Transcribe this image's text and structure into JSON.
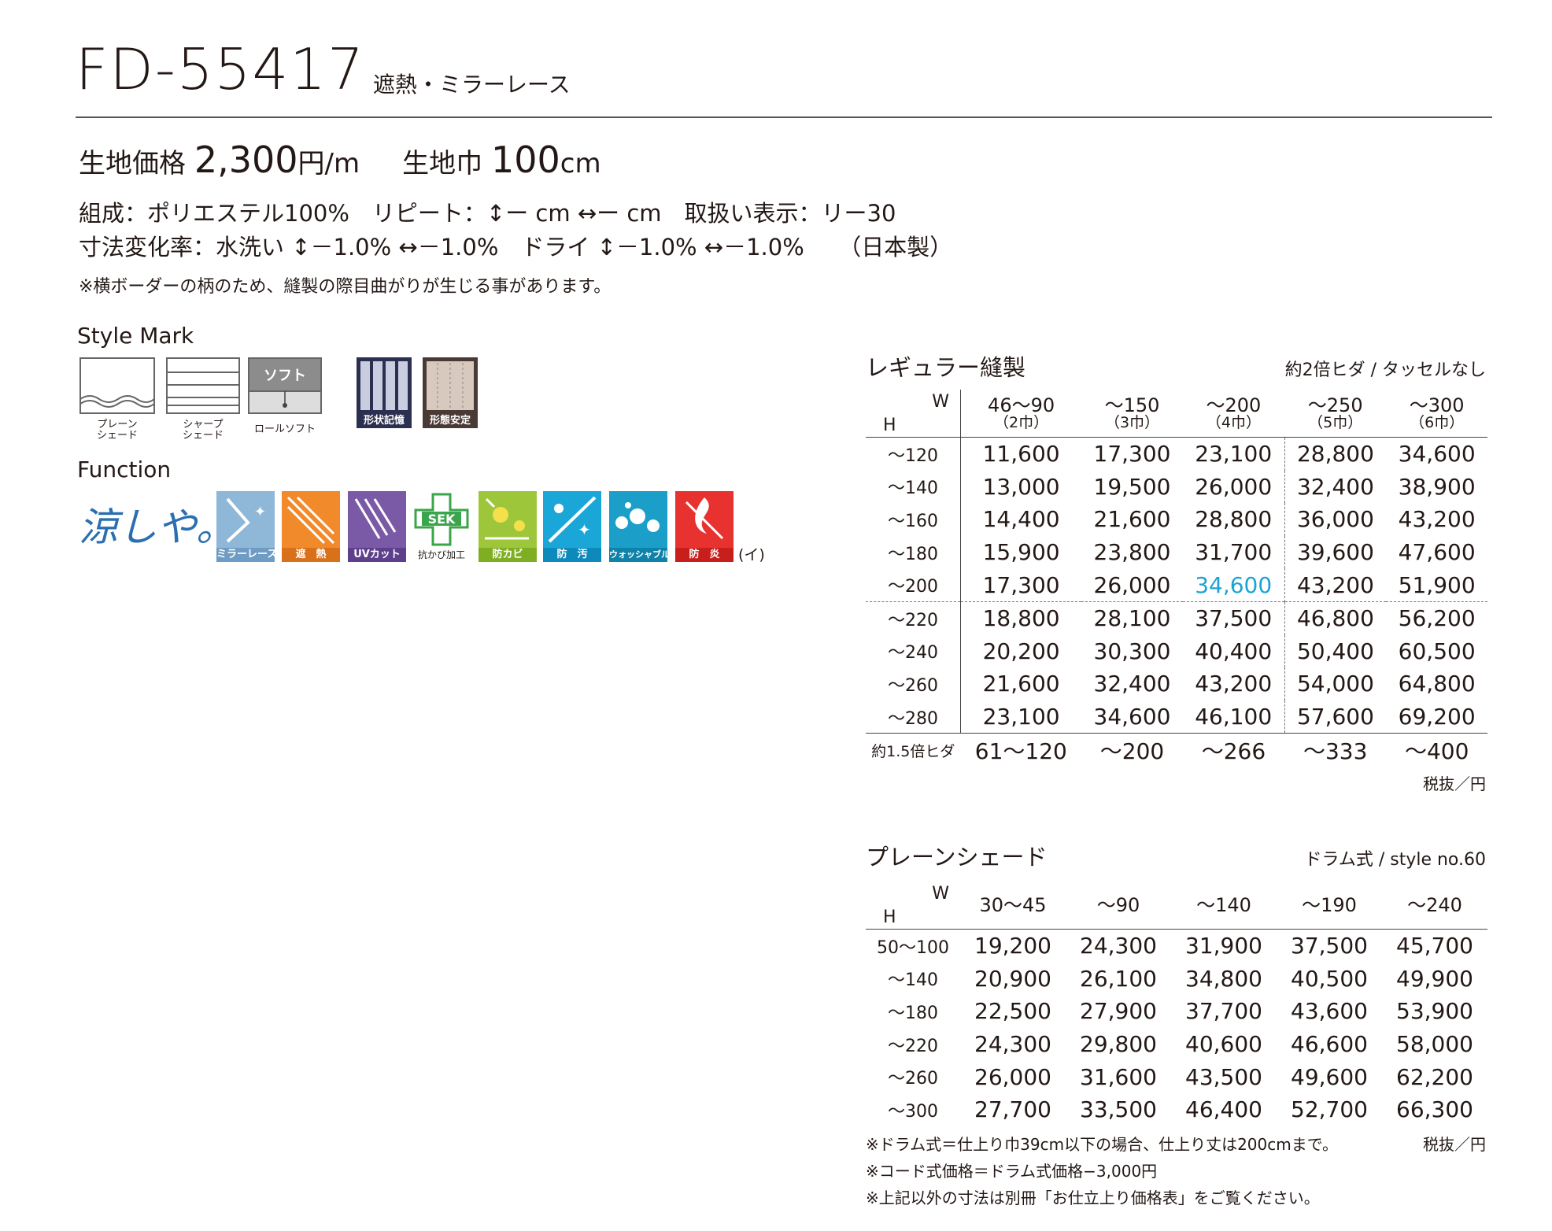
{
  "header": {
    "code": "FD-55417",
    "subtitle": "遮熱・ミラーレース"
  },
  "price": {
    "label": "生地価格",
    "value": "2,300",
    "unit": "円/m",
    "width_label": "生地巾",
    "width_value": "100",
    "width_unit": "cm"
  },
  "specs": {
    "line1": "組成：ポリエステル100%　リピート：↕ー cm ↔ー cm　取扱い表示：リー30",
    "line2": "寸法変化率：水洗い ↕－1.0% ↔－1.0%　ドライ ↕－1.0% ↔－1.0%　　（日本製）",
    "note": "※横ボーダーの柄のため、縫製の際目曲がりが生じる事があります。"
  },
  "style_mark": {
    "heading": "Style Mark",
    "items": [
      {
        "caption1": "プレーン",
        "caption2": "シェード",
        "icon": "plain-shade-icon"
      },
      {
        "caption1": "シャープ",
        "caption2": "シェード",
        "icon": "sharp-shade-icon"
      },
      {
        "caption1": "ロールソフト",
        "caption2": "",
        "label": "ソフト",
        "icon": "roll-soft-icon"
      },
      {
        "caption1": "形状記憶",
        "caption2": "",
        "icon": "shape-memory-icon"
      },
      {
        "caption1": "形態安定",
        "caption2": "",
        "icon": "form-stable-icon"
      }
    ]
  },
  "function": {
    "heading": "Function",
    "logo": "涼しや。",
    "items": [
      {
        "label": "ミラーレース",
        "color": "#8fb7d8",
        "icon": "mirror-lace-icon"
      },
      {
        "label": "遮　熱",
        "color": "#f08a2a",
        "icon": "heat-shield-icon"
      },
      {
        "label": "UVカット",
        "color": "#7a5aa6",
        "icon": "uv-cut-icon"
      },
      {
        "label": "SEK",
        "sub": "抗かび加工",
        "color": "#3aa54a",
        "icon": "sek-icon"
      },
      {
        "label": "防カビ",
        "color": "#9dc63a",
        "icon": "anti-mold-icon"
      },
      {
        "label": "防　汚",
        "color": "#1aa7d8",
        "icon": "anti-stain-icon"
      },
      {
        "label": "ウォッシャブル",
        "color": "#1b9fc8",
        "icon": "washable-icon"
      },
      {
        "label": "防　炎",
        "color": "#e8322f",
        "icon": "flame-retardant-icon"
      }
    ],
    "suffix": "(イ)"
  },
  "regular": {
    "title": "レギュラー縫製",
    "subtitle": "約2倍ヒダ / タッセルなし",
    "w_label": "W",
    "h_label": "H",
    "columns": [
      {
        "range": "46〜90",
        "sub": "（2巾）"
      },
      {
        "range": "〜150",
        "sub": "（3巾）"
      },
      {
        "range": "〜200",
        "sub": "（4巾）"
      },
      {
        "range": "〜250",
        "sub": "（5巾）"
      },
      {
        "range": "〜300",
        "sub": "（6巾）"
      }
    ],
    "rows": [
      {
        "h": "〜120",
        "values": [
          "11,600",
          "17,300",
          "23,100",
          "28,800",
          "34,600"
        ]
      },
      {
        "h": "〜140",
        "values": [
          "13,000",
          "19,500",
          "26,000",
          "32,400",
          "38,900"
        ]
      },
      {
        "h": "〜160",
        "values": [
          "14,400",
          "21,600",
          "28,800",
          "36,000",
          "43,200"
        ]
      },
      {
        "h": "〜180",
        "values": [
          "15,900",
          "23,800",
          "31,700",
          "39,600",
          "47,600"
        ]
      },
      {
        "h": "〜200",
        "values": [
          "17,300",
          "26,000",
          "34,600",
          "43,200",
          "51,900"
        ]
      },
      {
        "h": "〜220",
        "values": [
          "18,800",
          "28,100",
          "37,500",
          "46,800",
          "56,200"
        ]
      },
      {
        "h": "〜240",
        "values": [
          "20,200",
          "30,300",
          "40,400",
          "50,400",
          "60,500"
        ]
      },
      {
        "h": "〜260",
        "values": [
          "21,600",
          "32,400",
          "43,200",
          "54,000",
          "64,800"
        ]
      },
      {
        "h": "〜280",
        "values": [
          "23,100",
          "34,600",
          "46,100",
          "57,600",
          "69,200"
        ]
      }
    ],
    "fold_row": {
      "label": "約1.5倍ヒダ",
      "values": [
        "61〜120",
        "〜200",
        "〜266",
        "〜333",
        "〜400"
      ]
    },
    "unit": "税抜／円",
    "highlight_color": "#1ba3d6"
  },
  "plain": {
    "title": "プレーンシェード",
    "subtitle": "ドラム式 / style no.60",
    "w_label": "W",
    "h_label": "H",
    "columns": [
      "30〜45",
      "〜90",
      "〜140",
      "〜190",
      "〜240"
    ],
    "rows": [
      {
        "h": "50〜100",
        "values": [
          "19,200",
          "24,300",
          "31,900",
          "37,500",
          "45,700"
        ]
      },
      {
        "h": "〜140",
        "values": [
          "20,900",
          "26,100",
          "34,800",
          "40,500",
          "49,900"
        ]
      },
      {
        "h": "〜180",
        "values": [
          "22,500",
          "27,900",
          "37,700",
          "43,600",
          "53,900"
        ]
      },
      {
        "h": "〜220",
        "values": [
          "24,300",
          "29,800",
          "40,600",
          "46,600",
          "58,000"
        ]
      },
      {
        "h": "〜260",
        "values": [
          "26,000",
          "31,600",
          "43,500",
          "49,600",
          "62,200"
        ]
      },
      {
        "h": "〜300",
        "values": [
          "27,700",
          "33,500",
          "46,400",
          "52,700",
          "66,300"
        ]
      }
    ],
    "unit": "税抜／円",
    "notes": [
      "※ドラム式＝仕上り巾39cm以下の場合、仕上り丈は200cmまで。",
      "※コード式価格＝ドラム式価格−3,000円",
      "※上記以外の寸法は別冊「お仕立上り価格表」をご覧ください。"
    ]
  }
}
